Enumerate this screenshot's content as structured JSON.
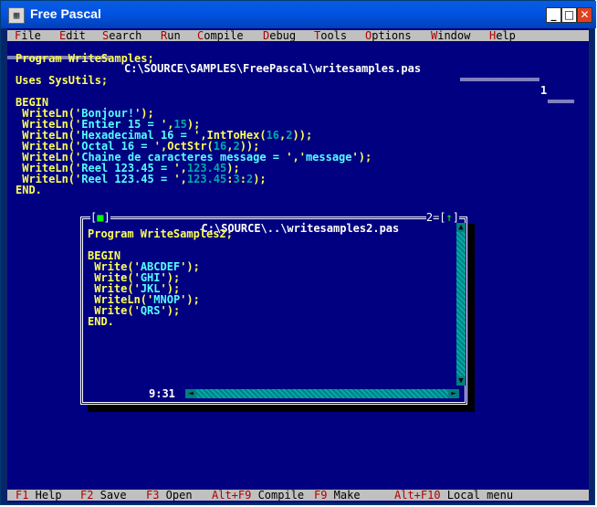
{
  "window": {
    "title": "Free Pascal",
    "app_icon": "pascal-app-icon",
    "minimize_glyph": "_",
    "maximize_glyph": "□",
    "close_glyph": "✕"
  },
  "menu": {
    "items": [
      "File",
      "Edit",
      "Search",
      "Run",
      "Compile",
      "Debug",
      "Tools",
      "Options",
      "Window",
      "Help"
    ]
  },
  "editor1": {
    "title": "C:\\SOURCE\\SAMPLES\\FreePascal\\writesamples.pas",
    "window_number": "1",
    "lines": [
      "Program WriteSamples;",
      "",
      "Uses SysUtils;",
      "",
      "BEGIN",
      " WriteLn('Bonjour!');",
      " WriteLn('Entier 15 = ',15);",
      " WriteLn('Hexadecimal 16 = ',IntToHex(16,2));",
      " WriteLn('Octal 16 = ',OctStr(16,2));",
      " WriteLn('Chaine de caracteres message = ','message');",
      " WriteLn('Reel 123.45 = ',123.45);",
      " WriteLn('Reel 123.45 = ',123.45:3:2);",
      "END."
    ]
  },
  "editor2": {
    "title": "C:\\SOURCE\\..\\writesamples2.pas",
    "window_number": "2",
    "close_glyph": "■",
    "zoom_glyph": "↑",
    "cursor_position": "9:31",
    "lines": [
      "Program WriteSamples2;",
      "",
      "BEGIN",
      " Write('ABCDEF');",
      " Write('GHI');",
      " Write('JKL');",
      " WriteLn('MNOP');",
      " Write('QRS');",
      "END."
    ]
  },
  "statusbar": {
    "items": [
      {
        "key": "F1",
        "label": "Help"
      },
      {
        "key": "F2",
        "label": "Save"
      },
      {
        "key": "F3",
        "label": "Open"
      },
      {
        "key": "Alt+F9",
        "label": "Compile"
      },
      {
        "key": "F9",
        "label": "Make"
      },
      {
        "key": "Alt+F10",
        "label": "Local menu"
      }
    ]
  },
  "colors": {
    "background": "#000080",
    "code_text": "#ffff55",
    "string_text": "#55ffff",
    "number_text": "#00aaaa",
    "menu_bg": "#c0c0c0",
    "hotkey": "#b00000"
  }
}
